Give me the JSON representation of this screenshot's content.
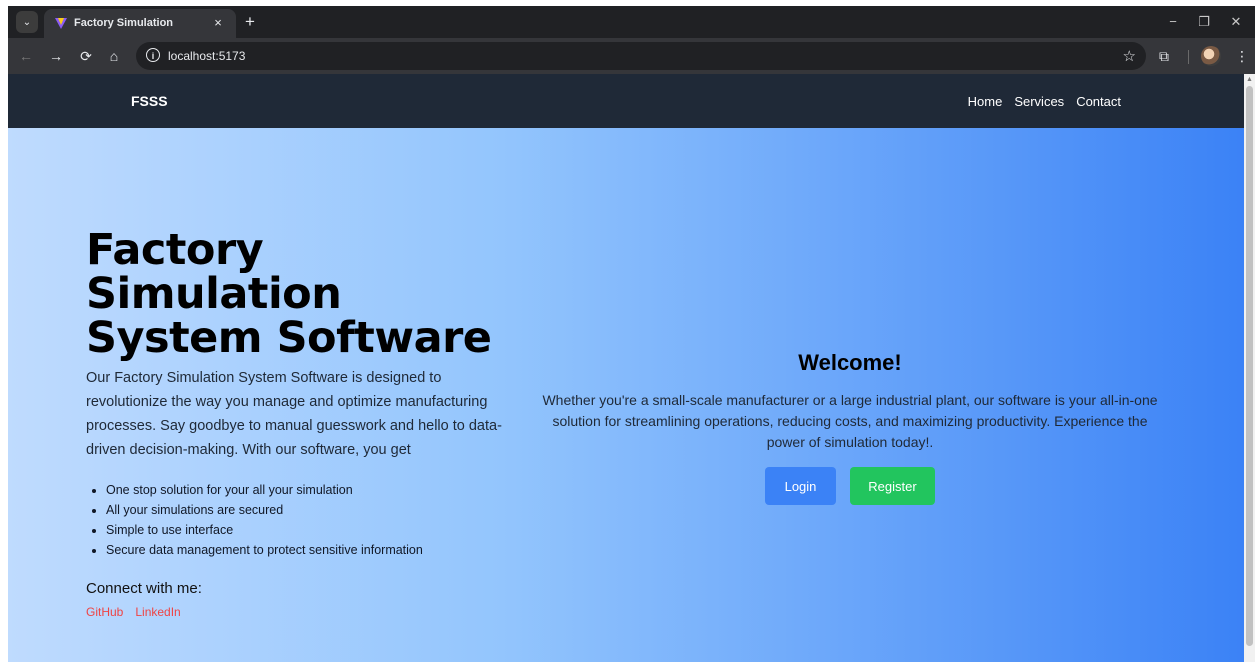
{
  "browser": {
    "tab_title": "Factory Simulation",
    "tab_close": "×",
    "new_tab": "+",
    "url": "localhost:5173",
    "window_controls": {
      "minimize": "−",
      "restore": "❐",
      "close": "✕"
    }
  },
  "navbar": {
    "brand": "FSSS",
    "links": [
      "Home",
      "Services",
      "Contact"
    ]
  },
  "hero": {
    "title_lines": [
      "Factory",
      "Simulation",
      "System Software"
    ],
    "intro": "Our Factory Simulation System Software is designed to revolutionize the way you manage and optimize manufacturing processes. Say goodbye to manual guesswork and hello to data-driven decision-making. With our software, you get",
    "features": [
      "One stop solution for your all your simulation",
      "All your simulations are secured",
      "Simple to use interface",
      "Secure data management to protect sensitive information"
    ],
    "connect_heading": "Connect with me:",
    "social_links": [
      "GitHub",
      "LinkedIn"
    ]
  },
  "welcome": {
    "heading": "Welcome!",
    "text": "Whether you're a small-scale manufacturer or a large industrial plant, our software is your all-in-one solution for streamlining operations, reducing costs, and maximizing productivity. Experience the power of simulation today!.",
    "login_label": "Login",
    "register_label": "Register"
  },
  "colors": {
    "navbar_bg": "#1f2937",
    "hero_gradient_start": "#bfdbfe",
    "hero_gradient_end": "#3b82f6",
    "login_button": "#3b82f6",
    "register_button": "#22c55e",
    "social_link": "#ef4444"
  },
  "icons": [
    "tab-list-icon",
    "favicon-icon",
    "close-icon",
    "plus-icon",
    "back-arrow-icon",
    "forward-arrow-icon",
    "reload-icon",
    "home-icon",
    "site-info-icon",
    "star-icon",
    "extensions-icon",
    "avatar-icon",
    "more-icon"
  ]
}
